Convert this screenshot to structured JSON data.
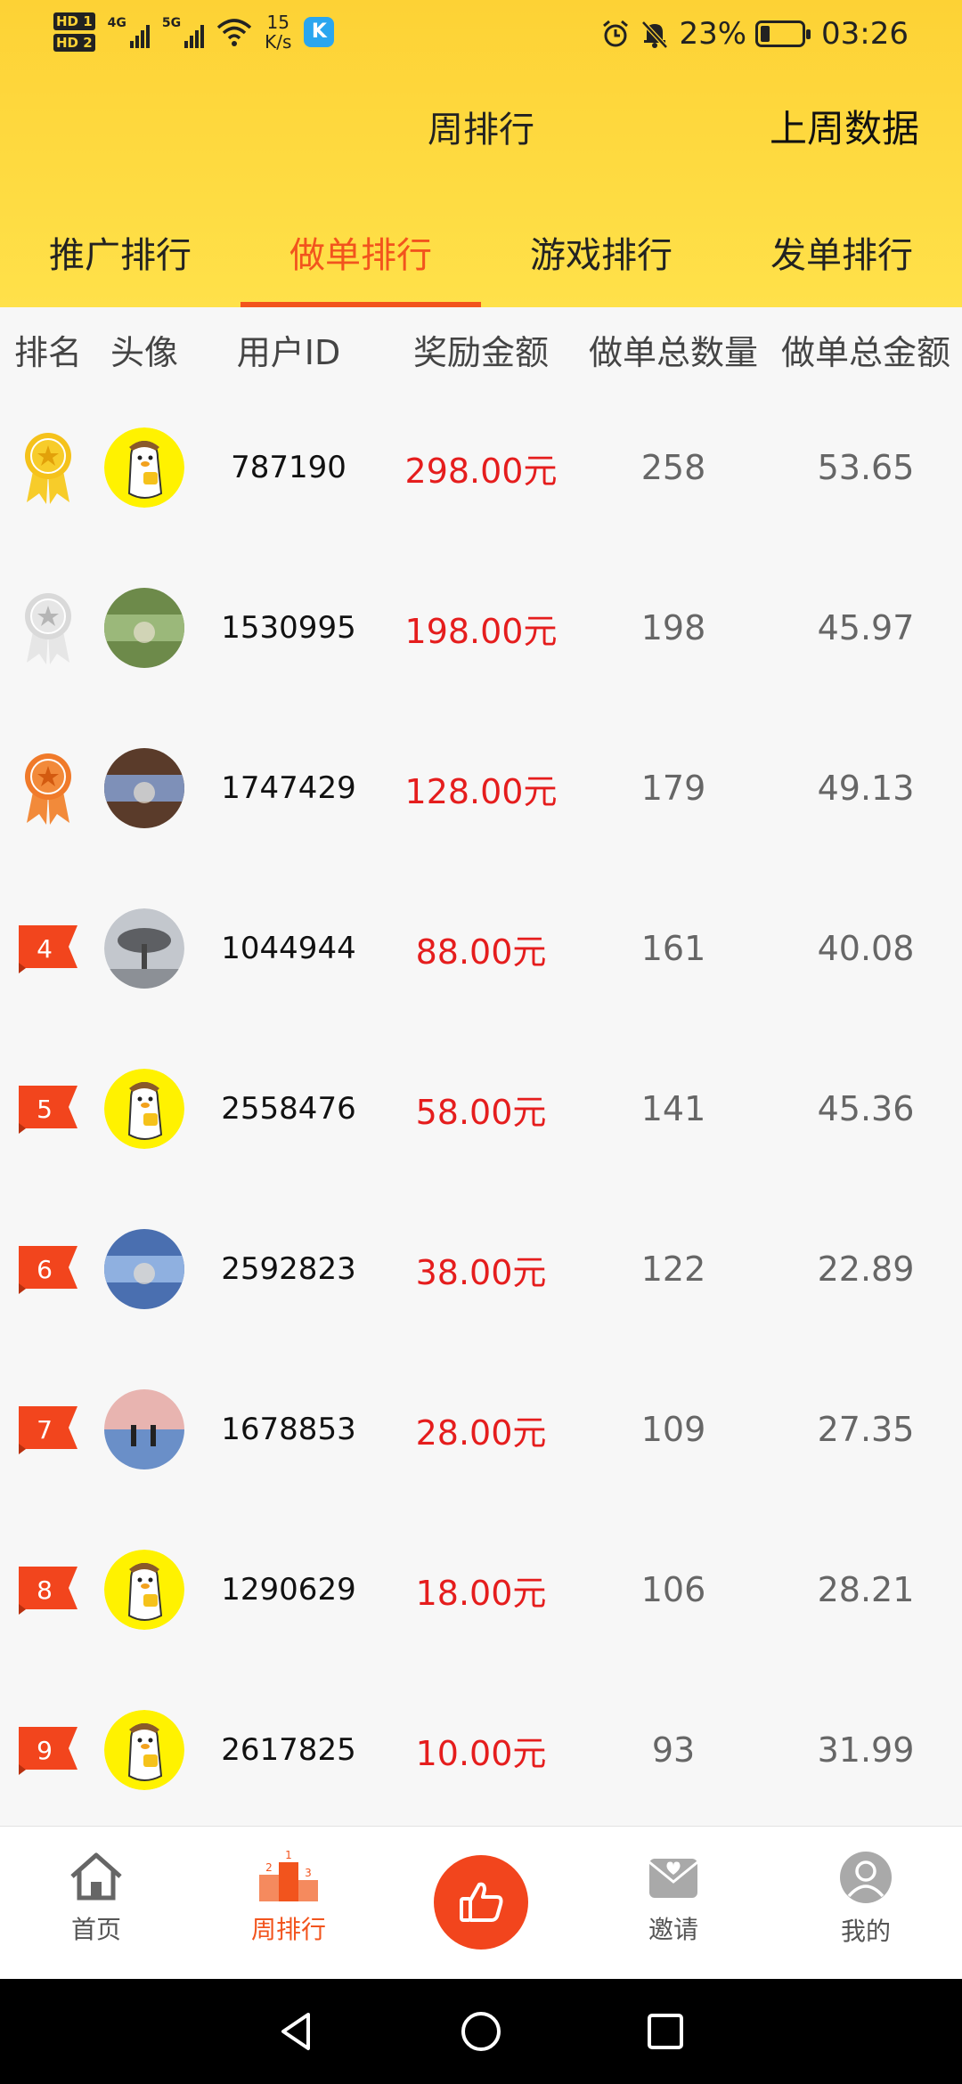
{
  "status_bar": {
    "speed_value": "15",
    "speed_unit": "K/s",
    "battery": "23%",
    "battery_level": 0.23,
    "time": "03:26",
    "network_4g": "4G",
    "network_5g": "5G",
    "hd1": "HD 1",
    "hd2": "HD 2",
    "k_badge": "K"
  },
  "header": {
    "title": "周排行",
    "last_week": "上周数据"
  },
  "tabs": [
    {
      "label": "推广排行"
    },
    {
      "label": "做单排行"
    },
    {
      "label": "游戏排行"
    },
    {
      "label": "发单排行"
    }
  ],
  "active_tab": "做单排行",
  "table": {
    "headers": [
      "排名",
      "头像",
      "用户ID",
      "奖励金额",
      "做单总数量",
      "做单总金额"
    ],
    "rows": [
      {
        "rank": "1",
        "user_id": "787190",
        "reward": "298.00元",
        "count": "258",
        "amount": "53.65"
      },
      {
        "rank": "2",
        "user_id": "1530995",
        "reward": "198.00元",
        "count": "198",
        "amount": "45.97"
      },
      {
        "rank": "3",
        "user_id": "1747429",
        "reward": "128.00元",
        "count": "179",
        "amount": "49.13"
      },
      {
        "rank": "4",
        "user_id": "1044944",
        "reward": "88.00元",
        "count": "161",
        "amount": "40.08"
      },
      {
        "rank": "5",
        "user_id": "2558476",
        "reward": "58.00元",
        "count": "141",
        "amount": "45.36"
      },
      {
        "rank": "6",
        "user_id": "2592823",
        "reward": "38.00元",
        "count": "122",
        "amount": "22.89"
      },
      {
        "rank": "7",
        "user_id": "1678853",
        "reward": "28.00元",
        "count": "109",
        "amount": "27.35"
      },
      {
        "rank": "8",
        "user_id": "1290629",
        "reward": "18.00元",
        "count": "106",
        "amount": "28.21"
      },
      {
        "rank": "9",
        "user_id": "2617825",
        "reward": "10.00元",
        "count": "93",
        "amount": "31.99"
      }
    ]
  },
  "bottom_nav": [
    {
      "label": "首页",
      "icon": "home-icon"
    },
    {
      "label": "周排行",
      "icon": "podium-icon"
    },
    {
      "label": "",
      "icon": "thumbs-up-icon"
    },
    {
      "label": "邀请",
      "icon": "invite-envelope-icon"
    },
    {
      "label": "我的",
      "icon": "profile-icon"
    }
  ],
  "colors": {
    "header_yellow": "#fdd235",
    "accent_orange": "#f2541d",
    "reward_red": "#e51d1d"
  }
}
